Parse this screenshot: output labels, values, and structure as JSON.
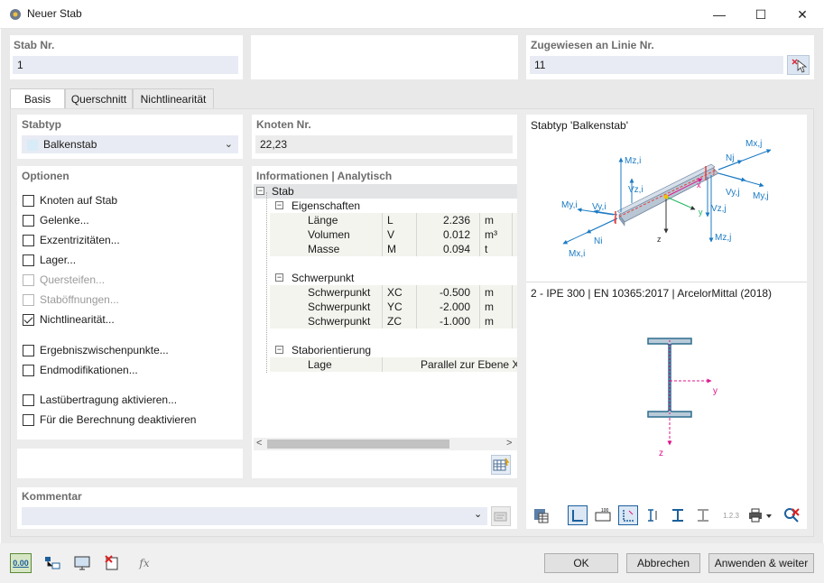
{
  "window": {
    "title": "Neuer Stab",
    "minimize": "—",
    "maximize": "☐",
    "close": "✕"
  },
  "stab_nr": {
    "label": "Stab Nr.",
    "value": "1"
  },
  "zugewiesen": {
    "label": "Zugewiesen an Linie Nr.",
    "value": "11"
  },
  "tabs": [
    "Basis",
    "Querschnitt",
    "Nichtlinearität"
  ],
  "stabtyp": {
    "label": "Stabtyp",
    "value": "Balkenstab"
  },
  "optionen": {
    "label": "Optionen",
    "items": [
      {
        "label": "Knoten auf Stab",
        "checked": false,
        "disabled": false
      },
      {
        "label": "Gelenke...",
        "checked": false,
        "disabled": false
      },
      {
        "label": "Exzentrizitäten...",
        "checked": false,
        "disabled": false
      },
      {
        "label": "Lager...",
        "checked": false,
        "disabled": false
      },
      {
        "label": "Quersteifen...",
        "checked": false,
        "disabled": true
      },
      {
        "label": "Staböffnungen...",
        "checked": false,
        "disabled": true
      },
      {
        "label": "Nichtlinearität...",
        "checked": true,
        "disabled": false
      },
      {
        "label": "Ergebniszwischenpunkte...",
        "checked": false,
        "disabled": false
      },
      {
        "label": "Endmodifikationen...",
        "checked": false,
        "disabled": false
      },
      {
        "label": "Lastübertragung aktivieren...",
        "checked": false,
        "disabled": false
      },
      {
        "label": "Für die Berechnung deaktivieren",
        "checked": false,
        "disabled": false
      }
    ]
  },
  "knoten": {
    "label": "Knoten Nr.",
    "value": "22,23"
  },
  "info": {
    "label": "Informationen | Analytisch",
    "root": "Stab",
    "eigenschaften": {
      "label": "Eigenschaften",
      "rows": [
        {
          "name": "Länge",
          "sym": "L",
          "value": "2.236",
          "unit": "m"
        },
        {
          "name": "Volumen",
          "sym": "V",
          "value": "0.012",
          "unit": "m³"
        },
        {
          "name": "Masse",
          "sym": "M",
          "value": "0.094",
          "unit": "t"
        }
      ]
    },
    "schwerpunkt": {
      "label": "Schwerpunkt",
      "rows": [
        {
          "name": "Schwerpunkt",
          "sym": "XC",
          "value": "-0.500",
          "unit": "m"
        },
        {
          "name": "Schwerpunkt",
          "sym": "YC",
          "value": "-2.000",
          "unit": "m"
        },
        {
          "name": "Schwerpunkt",
          "sym": "ZC",
          "value": "-1.000",
          "unit": "m"
        }
      ]
    },
    "orientierung": {
      "label": "Staborientierung",
      "rows": [
        {
          "name": "Lage",
          "value": "Parallel zur Ebene XY"
        }
      ]
    }
  },
  "preview": {
    "type_label": "Stabtyp 'Balkenstab'",
    "section_label": "2 - IPE 300 | EN 10365:2017 | ArcelorMittal (2018)",
    "axis_labels": {
      "y": "y",
      "z": "z"
    },
    "force_labels": {
      "mz_i": "Mz,i",
      "vz_i": "Vz,i",
      "my_i": "My,i",
      "vy_i": "Vy,i",
      "ni": "Ni",
      "mx_i": "Mx,i",
      "nj": "Nj",
      "mx_j": "Mx,j",
      "vy_j": "Vy,j",
      "my_j": "My,j",
      "vz_j": "Vz,j",
      "mz_j": "Mz,j",
      "i": "i",
      "j": "j",
      "x": "x",
      "y": "y",
      "z": "z"
    },
    "toolbar_value": "1.2.3"
  },
  "kommentar": {
    "label": "Kommentar",
    "value": ""
  },
  "buttons": {
    "ok": "OK",
    "cancel": "Abbrechen",
    "apply": "Anwenden & weiter"
  },
  "bottom_icons": {
    "units": "0.00"
  },
  "colors": {
    "accent": "#0a7cc2",
    "field": "#e8ebf3",
    "dialog": "#e9e9e9",
    "force": "#1c7bc4",
    "local_axis": "#e0148a"
  }
}
